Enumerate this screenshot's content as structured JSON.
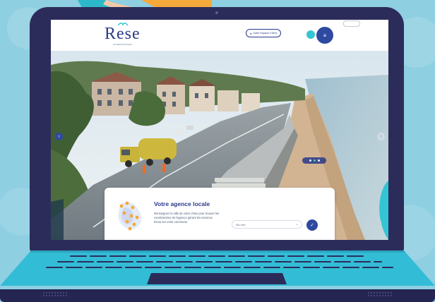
{
  "site": {
    "logo_text": "Rese",
    "logo_tagline": "LE SERVICE D'EAU",
    "client_button": "Votre Espace Client"
  },
  "card": {
    "title": "Votre agence locale",
    "description": "Renseignez la ville de votre choix pour trouver les coordonnées de l'agence gérant les services d'eau sur votre commune.",
    "select_placeholder": "Ma ville"
  },
  "colors": {
    "brand_blue": "#2a3a8a",
    "accent_teal": "#33c5d3",
    "laptop_frame": "#2c2c5a",
    "background": "#8ecfe2"
  },
  "icons": {
    "client": "user-icon",
    "menu": "menu-icon",
    "go": "check-icon",
    "chevron": "chevron-down-icon",
    "prev": "chevron-left-icon",
    "next": "chevron-right-icon"
  }
}
